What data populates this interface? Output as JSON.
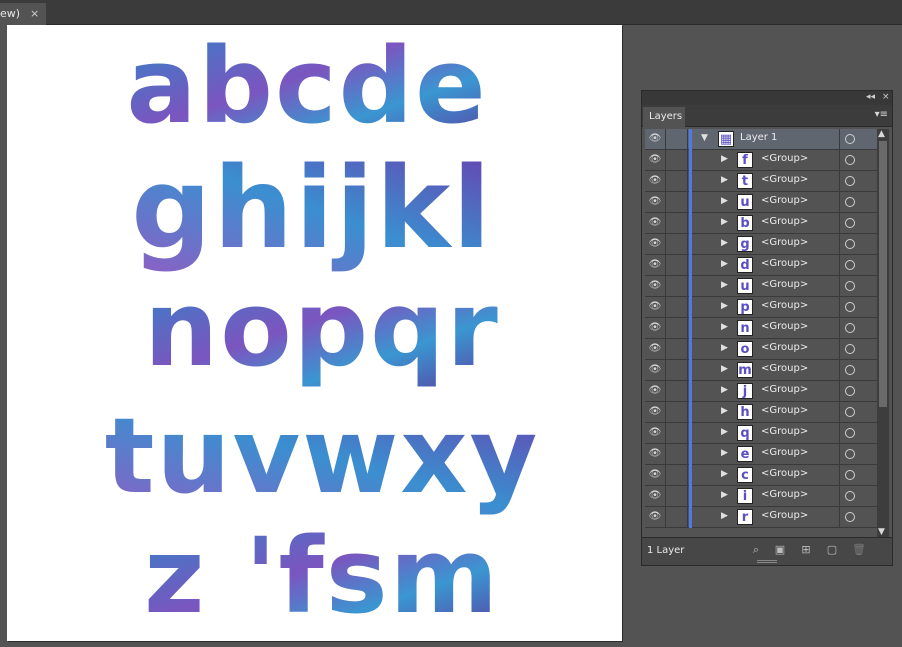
{
  "document_tab": {
    "title": "ew)",
    "close": "×"
  },
  "artboard": {
    "rows": [
      "abcde",
      "ghijkl",
      "nopqr",
      "tuvwxy",
      "z 'fsm"
    ]
  },
  "layers_panel": {
    "tab_label": "Layers",
    "collapse_icon": "◂◂",
    "close_icon": "×",
    "menu_icon": "▾≡",
    "top_layer": {
      "name": "Layer 1"
    },
    "groups": [
      {
        "thumb": "f",
        "name": "<Group>"
      },
      {
        "thumb": "t",
        "name": "<Group>"
      },
      {
        "thumb": "u",
        "name": "<Group>"
      },
      {
        "thumb": "b",
        "name": "<Group>"
      },
      {
        "thumb": "g",
        "name": "<Group>"
      },
      {
        "thumb": "d",
        "name": "<Group>"
      },
      {
        "thumb": "u",
        "name": "<Group>"
      },
      {
        "thumb": "p",
        "name": "<Group>"
      },
      {
        "thumb": "n",
        "name": "<Group>"
      },
      {
        "thumb": "o",
        "name": "<Group>"
      },
      {
        "thumb": "m",
        "name": "<Group>"
      },
      {
        "thumb": "j",
        "name": "<Group>"
      },
      {
        "thumb": "h",
        "name": "<Group>"
      },
      {
        "thumb": "q",
        "name": "<Group>"
      },
      {
        "thumb": "e",
        "name": "<Group>"
      },
      {
        "thumb": "c",
        "name": "<Group>"
      },
      {
        "thumb": "i",
        "name": "<Group>"
      },
      {
        "thumb": "r",
        "name": "<Group>"
      }
    ],
    "footer": {
      "layer_count": "1 Layer"
    }
  },
  "colors": {
    "accent": "#4d7be6",
    "ink_blue": "#2f7fc4",
    "ink_purple": "#6b3fa8"
  }
}
